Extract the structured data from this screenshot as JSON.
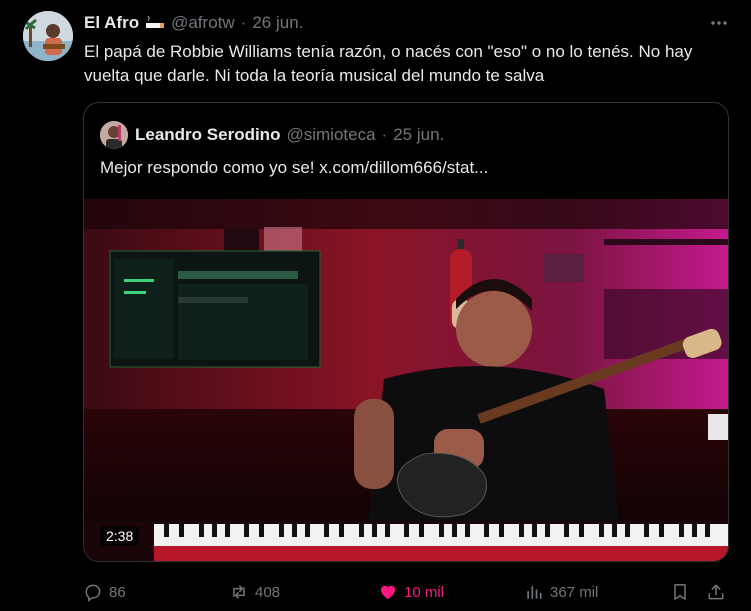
{
  "tweet": {
    "author_name": "El Afro",
    "author_handle": "@afrotw",
    "date": "26 jun.",
    "text": "El papá de Robbie Williams tenía razón, o  nacés con \"eso\" o no lo tenés. No hay vuelta que darle. Ni toda la teoría musical del mundo te salva"
  },
  "quoted": {
    "author_name": "Leandro Serodino",
    "author_handle": "@simioteca",
    "date": "25 jun.",
    "text": "Mejor respondo como yo se!  x.com/dillom666/stat...",
    "video_duration": "2:38"
  },
  "actions": {
    "replies": "86",
    "retweets": "408",
    "likes": "10 mil",
    "views": "367 mil"
  },
  "icons": [
    "more-icon",
    "reply-icon",
    "retweet-icon",
    "like-icon",
    "views-icon",
    "bookmark-icon",
    "share-icon"
  ],
  "colors": {
    "like": "#f91880",
    "muted": "#71767b",
    "text": "#e7e9ea",
    "border": "#2f3336"
  }
}
